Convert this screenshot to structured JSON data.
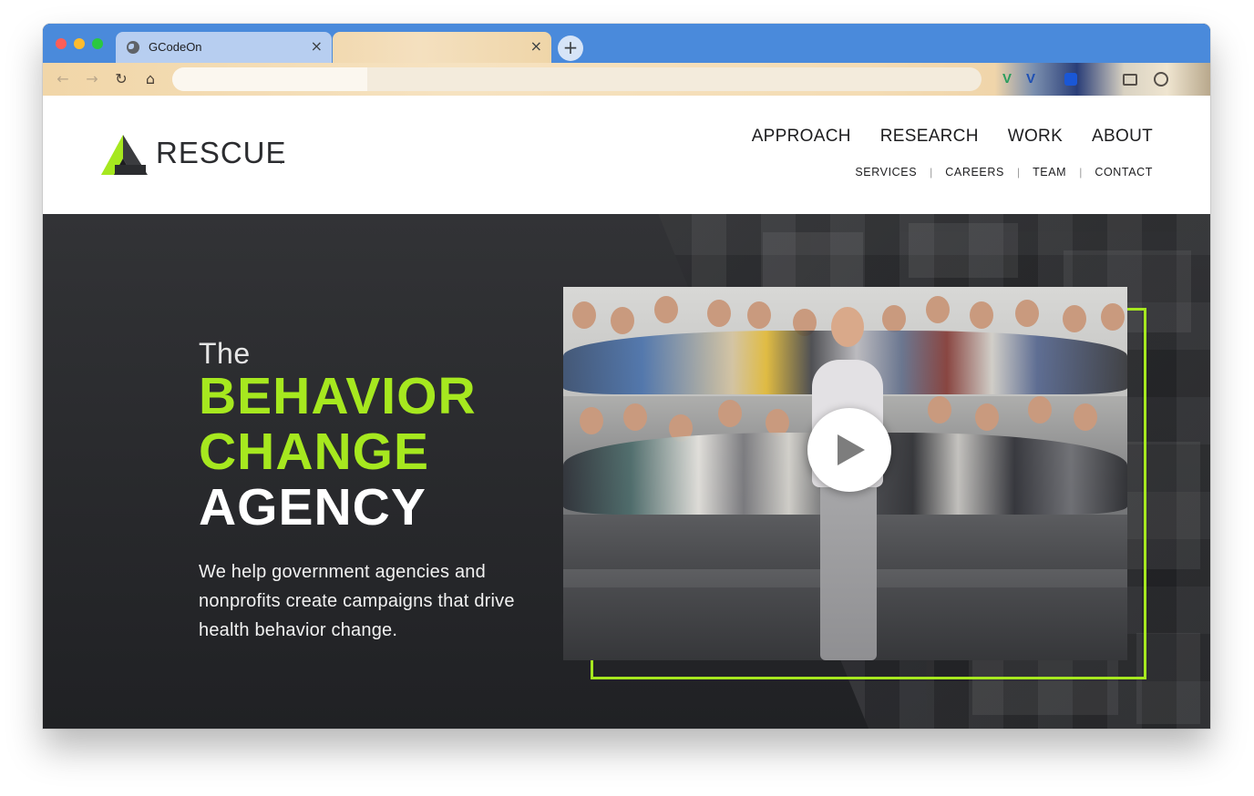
{
  "browser": {
    "tabs": [
      {
        "title": "GCodeOn",
        "active": true
      },
      {
        "title": "",
        "active": false
      }
    ],
    "new_tab_label": "+",
    "close_glyph": "×",
    "address_value": "",
    "icons": {
      "back": "arrow-left-icon",
      "forward": "arrow-right-icon",
      "reload": "reload-icon",
      "home": "home-icon",
      "favicon": "globe-icon"
    },
    "nav_glyphs": {
      "back": "←",
      "forward": "→",
      "reload": "↻",
      "home": "⌂"
    },
    "extensions": {
      "v1": "V",
      "v2": "V"
    }
  },
  "site": {
    "logo_text": "RESCUE",
    "logo_mark": ".",
    "main_nav": [
      "APPROACH",
      "RESEARCH",
      "WORK",
      "ABOUT"
    ],
    "sub_nav": [
      "SERVICES",
      "CAREERS",
      "TEAM",
      "CONTACT"
    ],
    "sub_nav_separator": "|"
  },
  "hero": {
    "the": "The",
    "line1": "BEHAVIOR",
    "line2": "CHANGE",
    "line3": "AGENCY",
    "description": "We help government agencies and nonprofits create campaigns that drive health behavior change."
  },
  "colors": {
    "accent": "#a6e81f",
    "hero_bg": "#2b2c2f",
    "tabbar": "#4a8adb"
  }
}
